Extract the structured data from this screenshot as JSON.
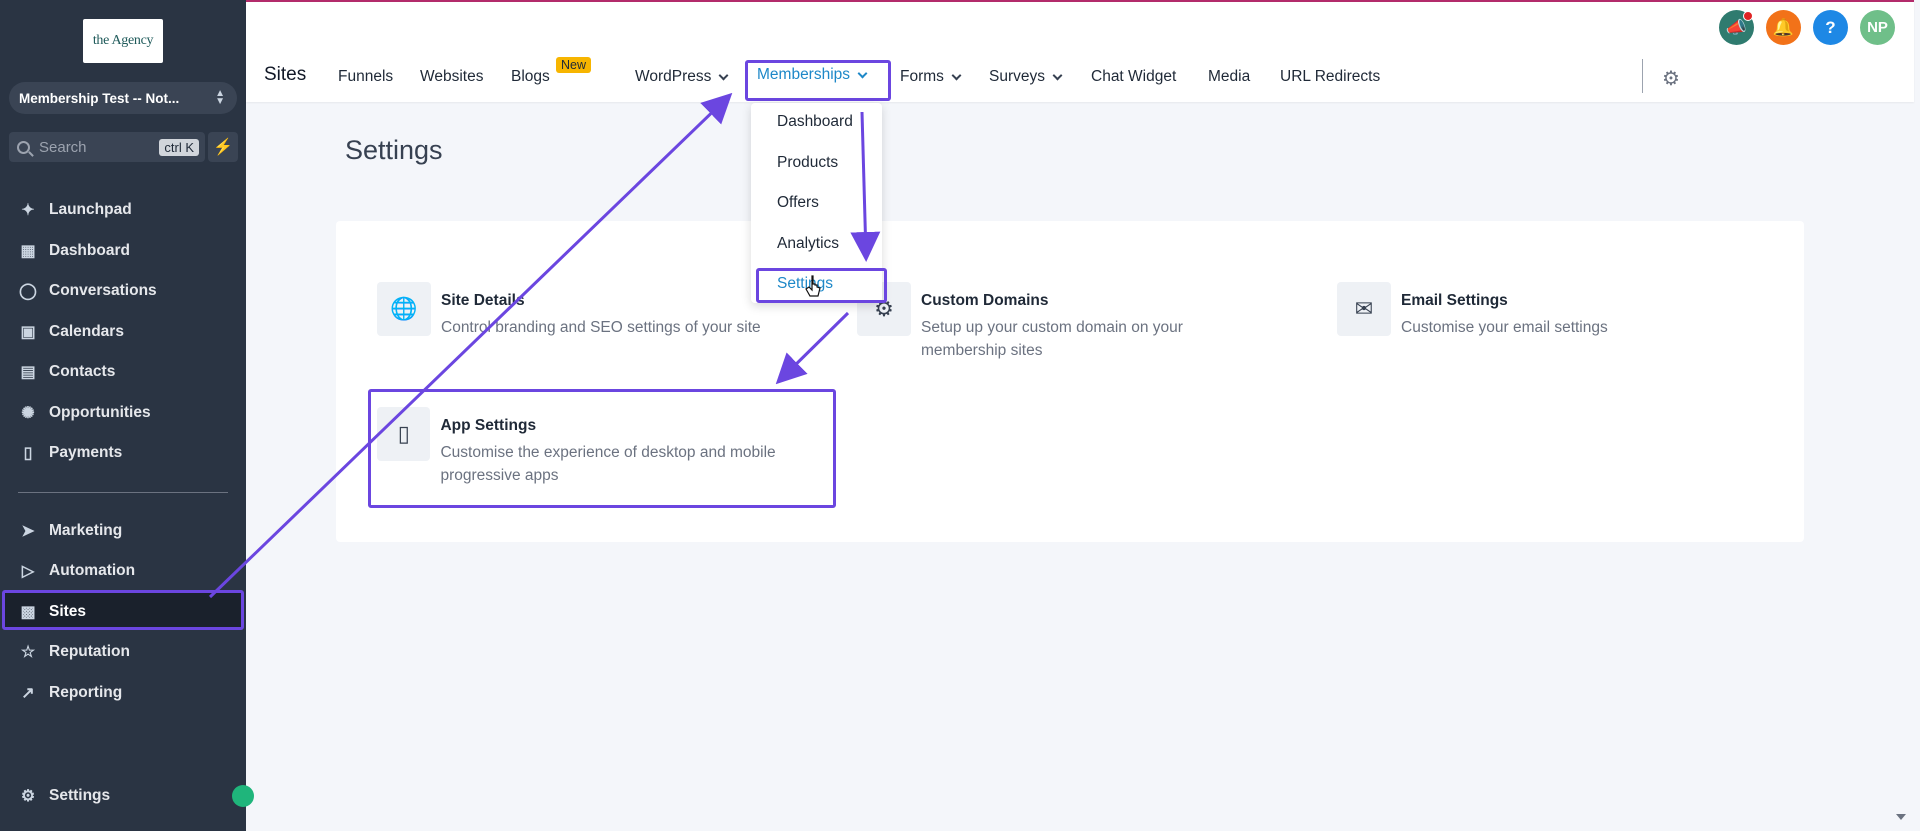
{
  "sidebar": {
    "logo_text": "the Agency",
    "account_name": "Membership Test -- Not...",
    "search_placeholder": "Search",
    "search_shortcut": "ctrl K",
    "items": [
      {
        "label": "Launchpad",
        "icon": "rocket-icon"
      },
      {
        "label": "Dashboard",
        "icon": "grid-icon"
      },
      {
        "label": "Conversations",
        "icon": "chat-icon"
      },
      {
        "label": "Calendars",
        "icon": "calendar-icon"
      },
      {
        "label": "Contacts",
        "icon": "contacts-icon"
      },
      {
        "label": "Opportunities",
        "icon": "opportunities-icon"
      },
      {
        "label": "Payments",
        "icon": "payments-icon"
      },
      {
        "label": "Marketing",
        "icon": "send-icon"
      },
      {
        "label": "Automation",
        "icon": "automation-icon"
      },
      {
        "label": "Sites",
        "icon": "sites-icon"
      },
      {
        "label": "Reputation",
        "icon": "star-icon"
      },
      {
        "label": "Reporting",
        "icon": "trend-icon"
      }
    ],
    "settings_label": "Settings"
  },
  "topbar": {
    "section_title": "Sites",
    "tabs": [
      {
        "label": "Funnels"
      },
      {
        "label": "Websites"
      },
      {
        "label": "Blogs"
      },
      {
        "label": "WordPress"
      },
      {
        "label": "Memberships"
      },
      {
        "label": "Forms"
      },
      {
        "label": "Surveys"
      },
      {
        "label": "Chat Widget"
      },
      {
        "label": "Media"
      },
      {
        "label": "URL Redirects"
      }
    ],
    "new_badge": "New",
    "avatar_initials": "NP",
    "help_glyph": "?"
  },
  "dropdown": {
    "items": [
      "Dashboard",
      "Products",
      "Offers",
      "Analytics",
      "Settings"
    ]
  },
  "main": {
    "page_title": "Settings",
    "settings": [
      {
        "title": "Site Details",
        "desc": "Control branding and SEO settings of your site",
        "icon": "globe-icon"
      },
      {
        "title": "Custom Domains",
        "desc": "Setup up your custom domain on your membership sites",
        "icon": "gear-icon"
      },
      {
        "title": "Email Settings",
        "desc": "Customise your email settings",
        "icon": "envelope-icon"
      },
      {
        "title": "App Settings",
        "desc": "Customise the experience of desktop and mobile progressive apps",
        "icon": "phone-icon"
      }
    ]
  },
  "colors": {
    "annotation": "#6b46e0",
    "active_tab": "#1e88c8",
    "sidebar_bg": "#2a3443"
  }
}
